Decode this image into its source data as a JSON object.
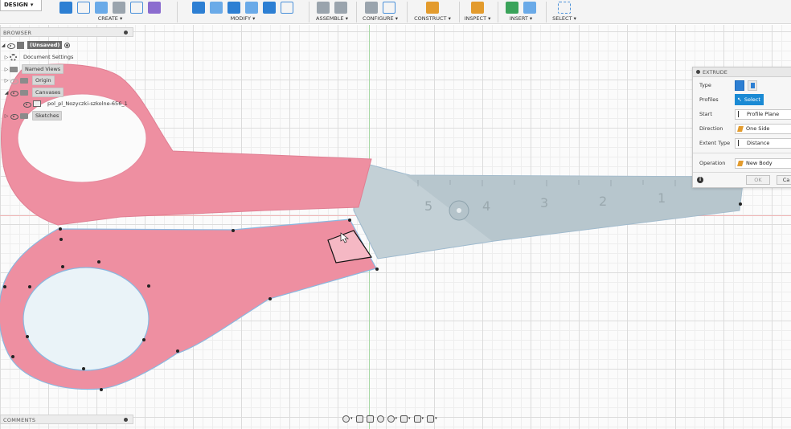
{
  "toolbar": {
    "workspace": "DESIGN",
    "groups": [
      {
        "label": "CREATE"
      },
      {
        "label": "MODIFY"
      },
      {
        "label": "ASSEMBLE"
      },
      {
        "label": "CONFIGURE"
      },
      {
        "label": "CONSTRUCT"
      },
      {
        "label": "INSPECT"
      },
      {
        "label": "INSERT"
      },
      {
        "label": "SELECT"
      }
    ]
  },
  "browser": {
    "title": "BROWSER",
    "items": [
      {
        "label": "(Unsaved)"
      },
      {
        "label": "Document Settings"
      },
      {
        "label": "Named Views"
      },
      {
        "label": "Origin"
      },
      {
        "label": "Canvases"
      },
      {
        "label": "pol_pl_Nozyczki-szkolne-656_1"
      },
      {
        "label": "Sketches"
      }
    ]
  },
  "comments": {
    "title": "COMMENTS"
  },
  "extrude": {
    "title": "EXTRUDE",
    "rows": [
      {
        "label": "Type",
        "value": ""
      },
      {
        "label": "Profiles",
        "value": "Select"
      },
      {
        "label": "Start",
        "value": "Profile Plane"
      },
      {
        "label": "Direction",
        "value": "One Side"
      },
      {
        "label": "Extent Type",
        "value": "Distance"
      },
      {
        "label": "Operation",
        "value": "New Body"
      }
    ],
    "ok_label": "OK",
    "cancel_label": "Ca"
  },
  "canvas_image": {
    "ruler_numbers": [
      "5",
      "4",
      "3",
      "2",
      "1"
    ]
  },
  "colors": {
    "handle": "#ee8fa1",
    "blade": "#c9d5da",
    "accent": "#1a8ad4",
    "sketch_line": "#8ab8e0"
  },
  "icons": [
    "eye-icon",
    "folder-icon",
    "gear-icon",
    "canvas-image-icon",
    "orbit-icon",
    "pan-icon",
    "zoom-icon",
    "display-settings-icon",
    "grid-icon",
    "info-icon",
    "cursor-hand-icon"
  ]
}
